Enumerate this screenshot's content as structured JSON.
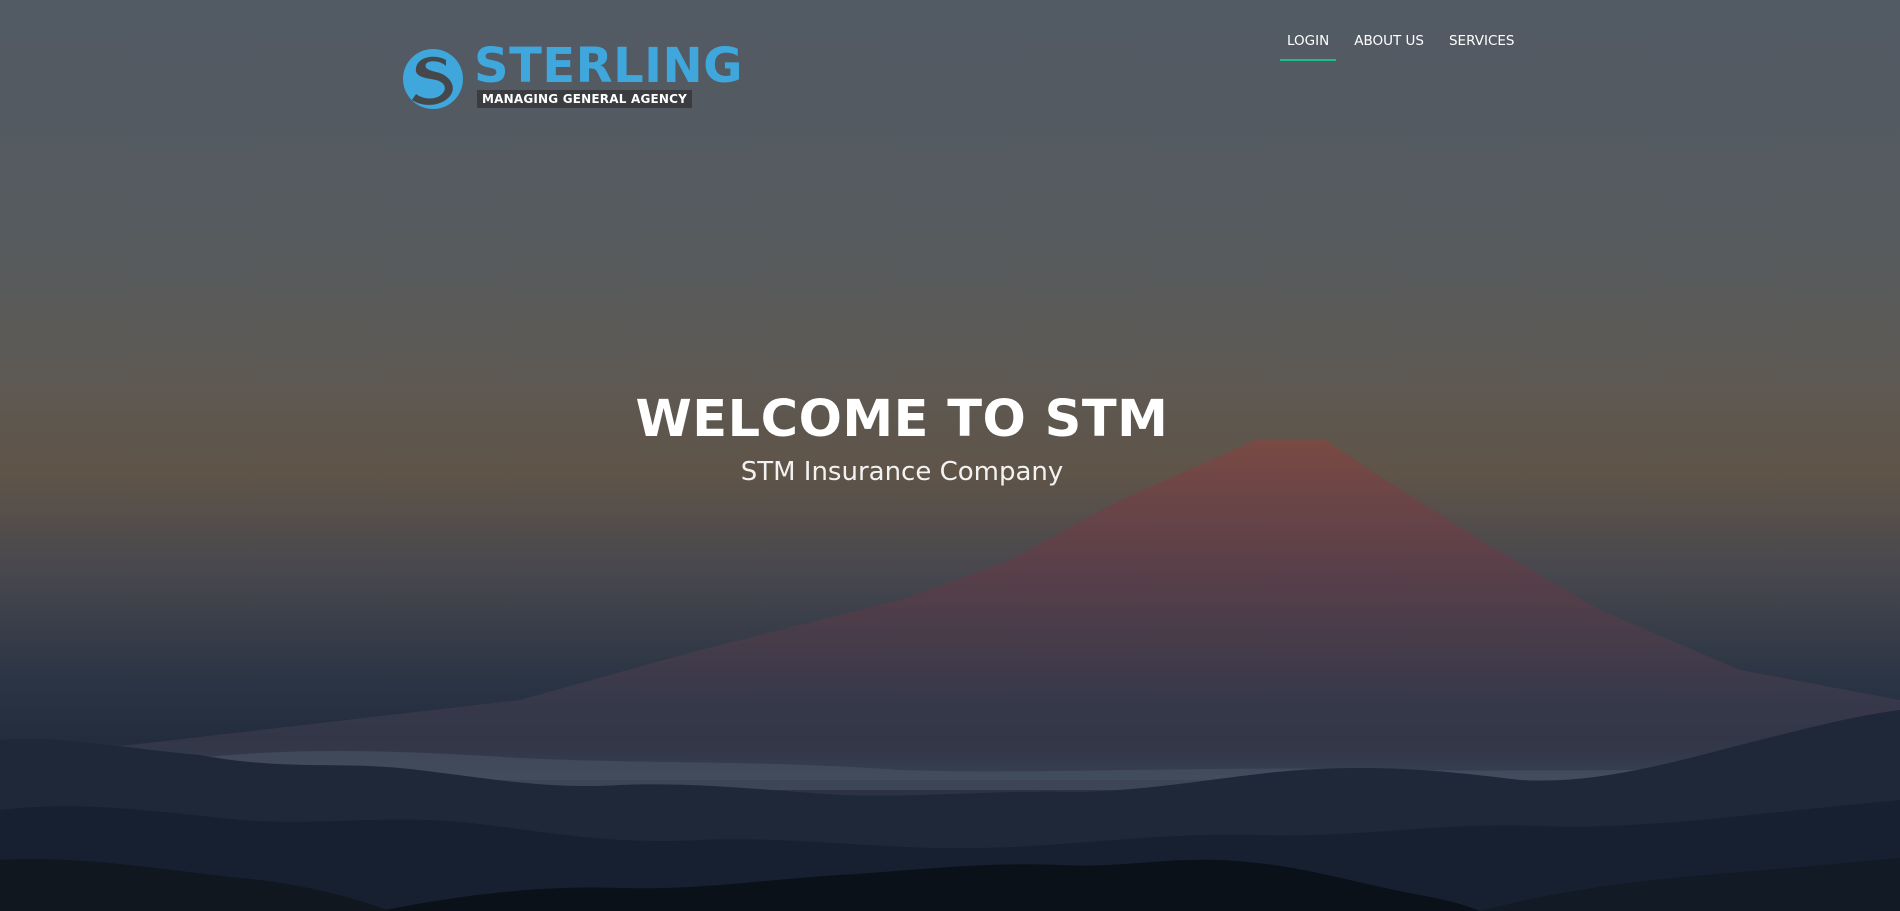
{
  "brand": {
    "name": "STERLING",
    "tagline": "MANAGING GENERAL AGENCY",
    "logo_icon": "s-swirl-icon",
    "brand_color": "#3fa7dc"
  },
  "nav": {
    "items": [
      {
        "label": "LOGIN",
        "active": true
      },
      {
        "label": "ABOUT US",
        "active": false
      },
      {
        "label": "SERVICES",
        "active": false
      }
    ],
    "active_underline_color": "#1bbf8f"
  },
  "hero": {
    "title": "WELCOME TO STM",
    "subtitle": "STM Insurance Company",
    "background": "mountain-sunset-photo"
  }
}
